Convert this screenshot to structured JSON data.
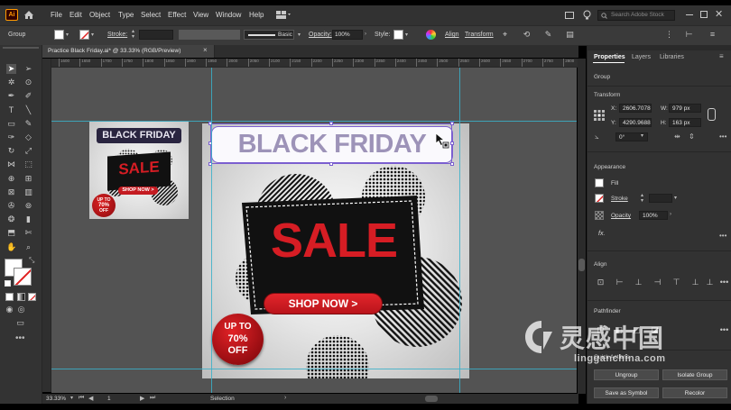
{
  "app": {
    "logo": "Ai"
  },
  "menu": [
    "File",
    "Edit",
    "Object",
    "Type",
    "Select",
    "Effect",
    "View",
    "Window",
    "Help"
  ],
  "search_placeholder": "Search Adobe Stock",
  "control_bar": {
    "selection_type": "Group",
    "stroke_label": "Stroke:",
    "brush_label": "Basic",
    "opacity_label": "Opacity:",
    "opacity_value": "100%",
    "style_label": "Style:",
    "align_label": "Align",
    "transform_label": "Transform"
  },
  "document": {
    "tab_title": "Practice Black Friday.ai* @ 33.33% (RGB/Preview)",
    "zoom": "33.33%",
    "artboard_num": "1",
    "status_tool": "Selection"
  },
  "ruler_ticks": [
    "1600",
    "1650",
    "1700",
    "1750",
    "1800",
    "1850",
    "1900",
    "1950",
    "2000",
    "2050",
    "2100",
    "2150",
    "2200",
    "2250",
    "2300",
    "2350",
    "2400",
    "2450",
    "2500",
    "2550",
    "2600",
    "2650",
    "2700",
    "2750",
    "2800"
  ],
  "artwork": {
    "headline": "BLACK FRIDAY",
    "sale": "SALE",
    "shop_button": "SHOP NOW >",
    "badge_line1": "UP TO",
    "badge_line2": "70%",
    "badge_line3": "OFF"
  },
  "panel": {
    "tabs": [
      "Properties",
      "Layers",
      "Libraries"
    ],
    "active_tab": "Properties",
    "selection": "Group",
    "transform": {
      "title": "Transform",
      "x_label": "X:",
      "x_value": "2606.7078",
      "y_label": "Y:",
      "y_value": "4290.9688",
      "w_label": "W:",
      "w_value": "979 px",
      "h_label": "H:",
      "h_value": "163 px",
      "angle_value": "0°"
    },
    "appearance": {
      "title": "Appearance",
      "fill_label": "Fill",
      "stroke_label": "Stroke",
      "opacity_label": "Opacity",
      "opacity_value": "100%",
      "fx_label": "fx."
    },
    "align_title": "Align",
    "pathfinder_title": "Pathfinder",
    "quick_actions": {
      "title": "Quick Actions",
      "ungroup": "Ungroup",
      "isolate": "Isolate Group",
      "save_symbol": "Save as Symbol",
      "recolor": "Recolor"
    }
  },
  "watermark": {
    "cn": "灵感中国",
    "url": "lingganchina.com"
  },
  "colors": {
    "accent_purple": "#7b5fd0",
    "guide_cyan": "#39b0c9",
    "sale_red": "#d61d24",
    "headline_purple": "#9d93b8",
    "ui_dark": "#323232"
  }
}
